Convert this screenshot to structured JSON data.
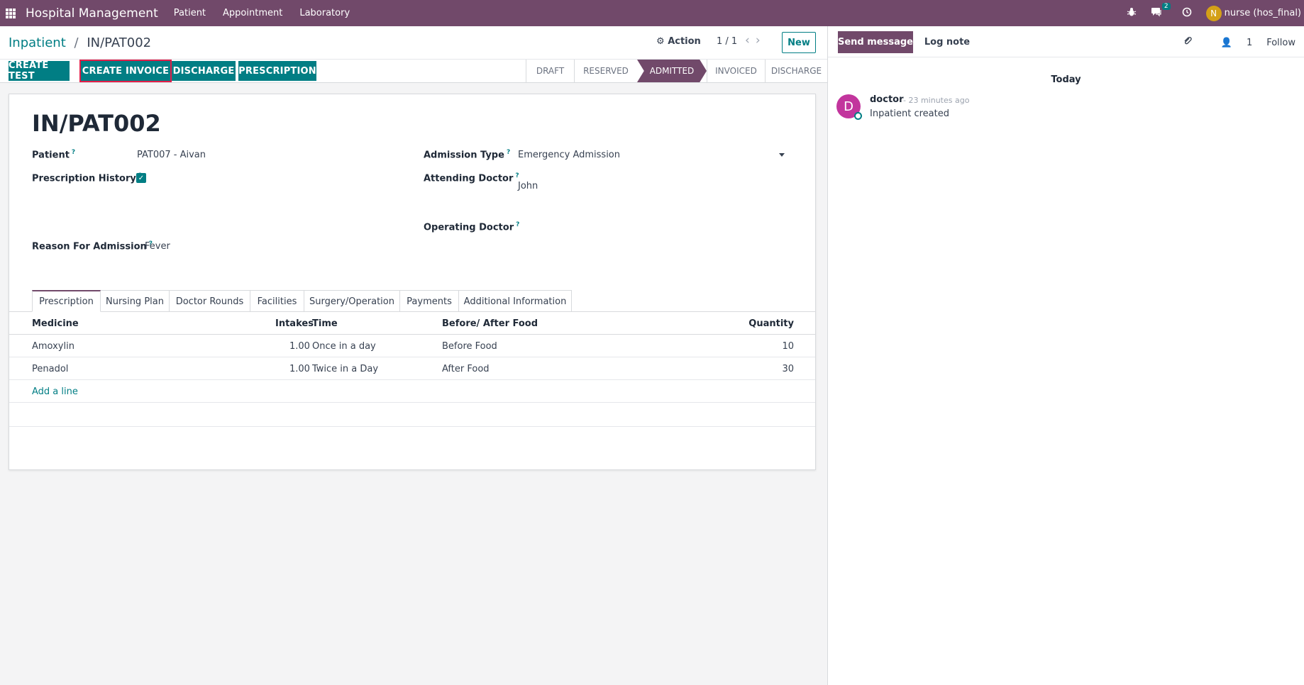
{
  "navbar": {
    "brand": "Hospital Management",
    "menu": [
      "Patient",
      "Appointment",
      "Laboratory"
    ],
    "messages_count": "2",
    "user_initial": "N",
    "user_name": "nurse (hos_final)"
  },
  "control": {
    "breadcrumb_parent": "Inpatient",
    "breadcrumb_sep": "/",
    "breadcrumb_current": "IN/PAT002",
    "action_label": "Action",
    "pager": "1 / 1",
    "new_label": "New"
  },
  "buttons": {
    "create_test": "CREATE TEST",
    "create_invoice": "CREATE INVOICE",
    "discharge": "DISCHARGE",
    "prescription": "PRESCRIPTION"
  },
  "stages": [
    "DRAFT",
    "RESERVED",
    "ADMITTED",
    "INVOICED",
    "DISCHARGE"
  ],
  "active_stage": "ADMITTED",
  "form": {
    "title": "IN/PAT002",
    "patient_label": "Patient",
    "patient_value": "PAT007 - Aivan",
    "prescription_history_label": "Prescription History",
    "prescription_history_checked": true,
    "admission_type_label": "Admission Type",
    "admission_type_value": "Emergency Admission",
    "attending_doctor_label": "Attending Doctor",
    "attending_doctor_value": "John",
    "operating_doctor_label": "Operating Doctor",
    "reason_label": "Reason For Admission",
    "reason_value": "Fever",
    "help_mark": "?"
  },
  "tabs": [
    "Prescription",
    "Nursing Plan",
    "Doctor Rounds",
    "Facilities",
    "Surgery/Operation",
    "Payments",
    "Additional Information"
  ],
  "table": {
    "headers": {
      "medicine": "Medicine",
      "intakes": "Intakes",
      "time": "Time",
      "food": "Before/ After Food",
      "quantity": "Quantity"
    },
    "rows": [
      {
        "medicine": "Amoxylin",
        "intakes": "1.00",
        "time": "Once in a day",
        "food": "Before Food",
        "quantity": "10"
      },
      {
        "medicine": "Penadol",
        "intakes": "1.00",
        "time": "Twice in a Day",
        "food": "After Food",
        "quantity": "30"
      }
    ],
    "add_line": "Add a line"
  },
  "chatter": {
    "send_message": "Send message",
    "log_note": "Log note",
    "followers": "1",
    "follow": "Follow",
    "today": "Today",
    "message": {
      "avatar_initial": "D",
      "author": "doctor",
      "time": "- 23 minutes ago",
      "body": "Inpatient created"
    }
  },
  "colors": {
    "brand": "#71496a",
    "accent": "#017e84",
    "highlight": "#e11d48"
  }
}
